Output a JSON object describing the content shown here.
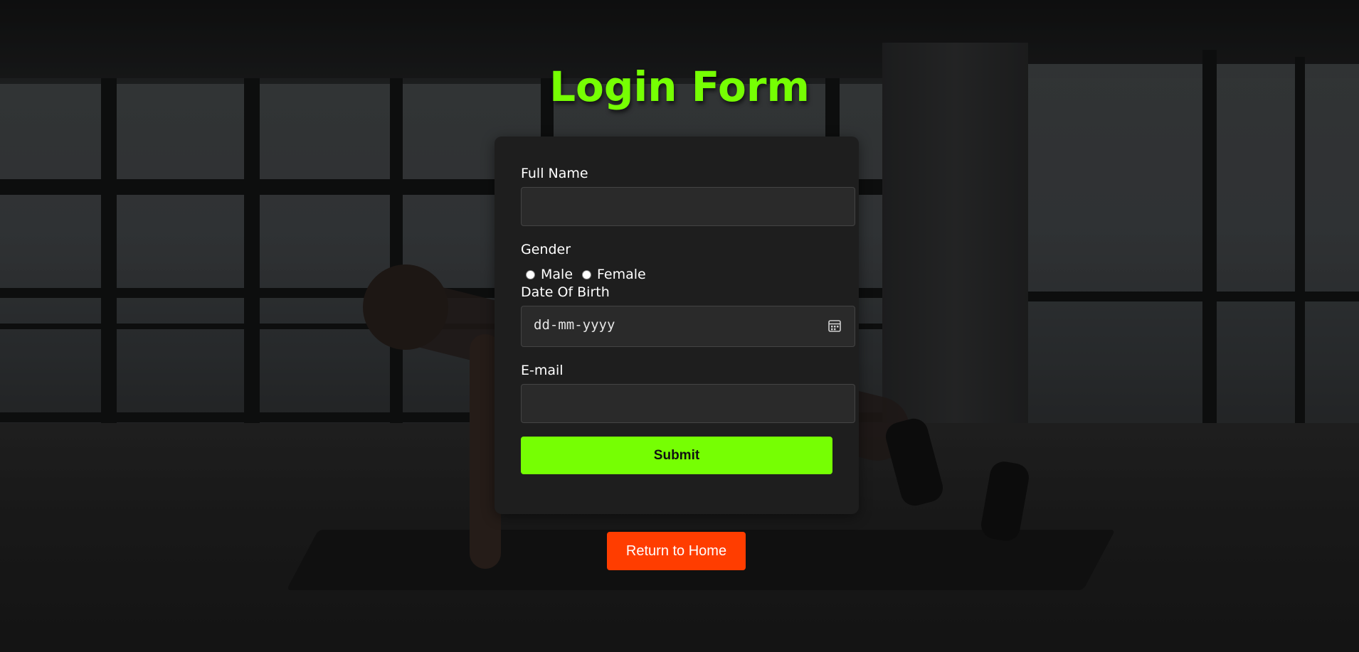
{
  "page": {
    "title": "Login Form"
  },
  "form": {
    "full_name": {
      "label": "Full Name",
      "value": ""
    },
    "gender": {
      "label": "Gender",
      "options": [
        "Male",
        "Female"
      ],
      "selected": null
    },
    "dob": {
      "label": "Date Of Birth",
      "placeholder": "dd-mm-yyyy"
    },
    "email": {
      "label": "E-mail",
      "value": ""
    },
    "submit_label": "Submit"
  },
  "return_home_label": "Return to Home",
  "colors": {
    "accent_green": "#76ff03",
    "return_orange": "#ff3d00",
    "card_bg": "#1e1e1e"
  }
}
